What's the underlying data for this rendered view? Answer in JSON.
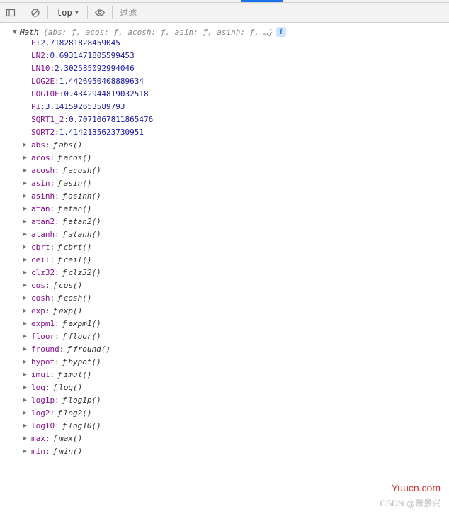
{
  "toolbar": {
    "context_label": "top",
    "filter_placeholder": "过滤"
  },
  "object": {
    "name": "Math",
    "preview_items": [
      "abs: ƒ",
      "acos: ƒ",
      "acosh: ƒ",
      "asin: ƒ",
      "asinh: ƒ",
      "…"
    ]
  },
  "constants": [
    {
      "key": "E",
      "value": "2.718281828459045"
    },
    {
      "key": "LN2",
      "value": "0.6931471805599453"
    },
    {
      "key": "LN10",
      "value": "2.302585092994046"
    },
    {
      "key": "LOG2E",
      "value": "1.4426950408889634"
    },
    {
      "key": "LOG10E",
      "value": "0.4342944819032518"
    },
    {
      "key": "PI",
      "value": "3.141592653589793"
    },
    {
      "key": "SQRT1_2",
      "value": "0.7071067811865476"
    },
    {
      "key": "SQRT2",
      "value": "1.4142135623730951"
    }
  ],
  "methods": [
    {
      "key": "abs",
      "fn": "abs()"
    },
    {
      "key": "acos",
      "fn": "acos()"
    },
    {
      "key": "acosh",
      "fn": "acosh()"
    },
    {
      "key": "asin",
      "fn": "asin()"
    },
    {
      "key": "asinh",
      "fn": "asinh()"
    },
    {
      "key": "atan",
      "fn": "atan()"
    },
    {
      "key": "atan2",
      "fn": "atan2()"
    },
    {
      "key": "atanh",
      "fn": "atanh()"
    },
    {
      "key": "cbrt",
      "fn": "cbrt()"
    },
    {
      "key": "ceil",
      "fn": "ceil()"
    },
    {
      "key": "clz32",
      "fn": "clz32()"
    },
    {
      "key": "cos",
      "fn": "cos()"
    },
    {
      "key": "cosh",
      "fn": "cosh()"
    },
    {
      "key": "exp",
      "fn": "exp()"
    },
    {
      "key": "expm1",
      "fn": "expm1()"
    },
    {
      "key": "floor",
      "fn": "floor()"
    },
    {
      "key": "fround",
      "fn": "fround()"
    },
    {
      "key": "hypot",
      "fn": "hypot()"
    },
    {
      "key": "imul",
      "fn": "imul()"
    },
    {
      "key": "log",
      "fn": "log()"
    },
    {
      "key": "log1p",
      "fn": "log1p()"
    },
    {
      "key": "log2",
      "fn": "log2()"
    },
    {
      "key": "log10",
      "fn": "log10()"
    },
    {
      "key": "max",
      "fn": "max()"
    },
    {
      "key": "min",
      "fn": "min()"
    }
  ],
  "watermark1": "Yuucn.com",
  "watermark2": "CSDN @萧景兴"
}
